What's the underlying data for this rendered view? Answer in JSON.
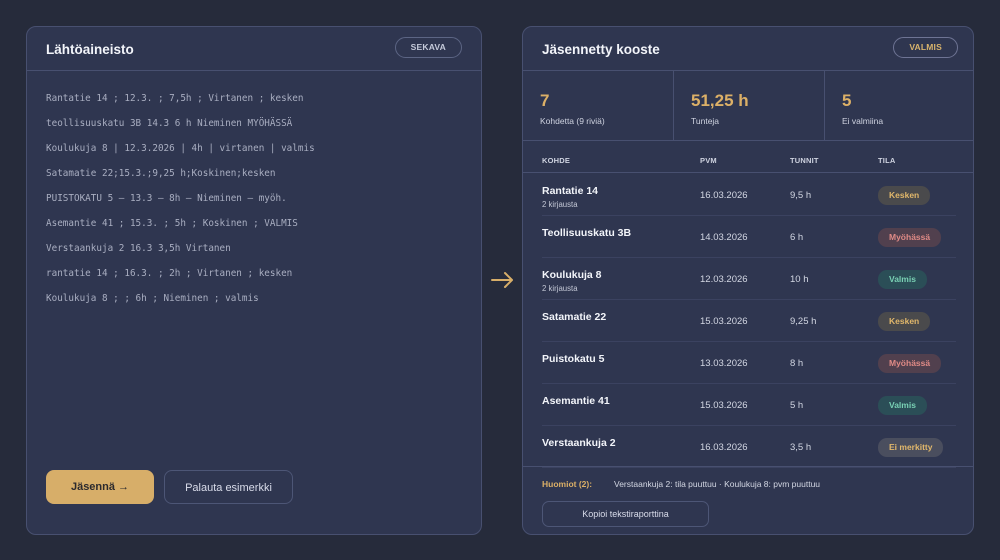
{
  "source": {
    "title": "Lähtöaineisto",
    "badge": "SEKAVA",
    "lines": [
      "Rantatie 14 ; 12.3. ; 7,5h ; Virtanen ; kesken",
      "teollisuuskatu 3B 14.3 6 h Nieminen MYÖHÄSSÄ",
      "Koulukuja 8 | 12.3.2026 | 4h | virtanen | valmis",
      "Satamatie 22;15.3.;9,25 h;Koskinen;kesken",
      "PUISTOKATU 5 — 13.3 — 8h — Nieminen — myöh.",
      "Asemantie 41 ; 15.3. ; 5h ; Koskinen ; VALMIS",
      "Verstaankuja 2 16.3 3,5h Virtanen",
      "rantatie 14 ; 16.3. ; 2h ; Virtanen ; kesken",
      "Koulukuja 8 ; ; 6h ; Nieminen ; valmis"
    ],
    "parse_button": "Jäsennä →",
    "reset_button": "Palauta esimerkki"
  },
  "result": {
    "title": "Jäsennetty kooste",
    "badge": "VALMIS",
    "stats": [
      {
        "value": "7",
        "label": "Kohdetta (9 riviä)"
      },
      {
        "value": "51,25 h",
        "label": "Tunteja"
      },
      {
        "value": "5",
        "label": "Ei valmiina"
      }
    ],
    "columns": [
      "KOHDE",
      "PVM",
      "TUNNIT",
      "TILA"
    ],
    "rows": [
      {
        "kohde": "Rantatie 14",
        "sub": "2 kirjausta",
        "pvm": "16.03.2026",
        "tunnit": "9,5 h",
        "tila": "Kesken",
        "status": "kesken"
      },
      {
        "kohde": "Teollisuuskatu 3B",
        "sub": "",
        "pvm": "14.03.2026",
        "tunnit": "6 h",
        "tila": "Myöhässä",
        "status": "myohassa"
      },
      {
        "kohde": "Koulukuja 8",
        "sub": "2 kirjausta",
        "pvm": "12.03.2026",
        "tunnit": "10 h",
        "tila": "Valmis",
        "status": "valmis"
      },
      {
        "kohde": "Satamatie 22",
        "sub": "",
        "pvm": "15.03.2026",
        "tunnit": "9,25 h",
        "tila": "Kesken",
        "status": "kesken"
      },
      {
        "kohde": "Puistokatu 5",
        "sub": "",
        "pvm": "13.03.2026",
        "tunnit": "8 h",
        "tila": "Myöhässä",
        "status": "myohassa"
      },
      {
        "kohde": "Asemantie 41",
        "sub": "",
        "pvm": "15.03.2026",
        "tunnit": "5 h",
        "tila": "Valmis",
        "status": "valmis"
      },
      {
        "kohde": "Verstaankuja 2",
        "sub": "",
        "pvm": "16.03.2026",
        "tunnit": "3,5 h",
        "tila": "Ei merkitty",
        "status": "eimerk"
      }
    ],
    "notes_label": "Huomiot (2):",
    "notes_text": "Verstaankuja 2: tila puuttuu · Koulukuja 8: pvm puuttuu",
    "copy_button": "Kopioi tekstiraporttina"
  },
  "colors": {
    "accent": "#d7ae69",
    "background": "#262b3b",
    "panel": "#2f3650",
    "status_kesken": "#e2b86b",
    "status_myohassa": "#e08a86",
    "status_valmis": "#79d1b4"
  },
  "icons": {
    "arrow": "arrow-right-icon"
  }
}
